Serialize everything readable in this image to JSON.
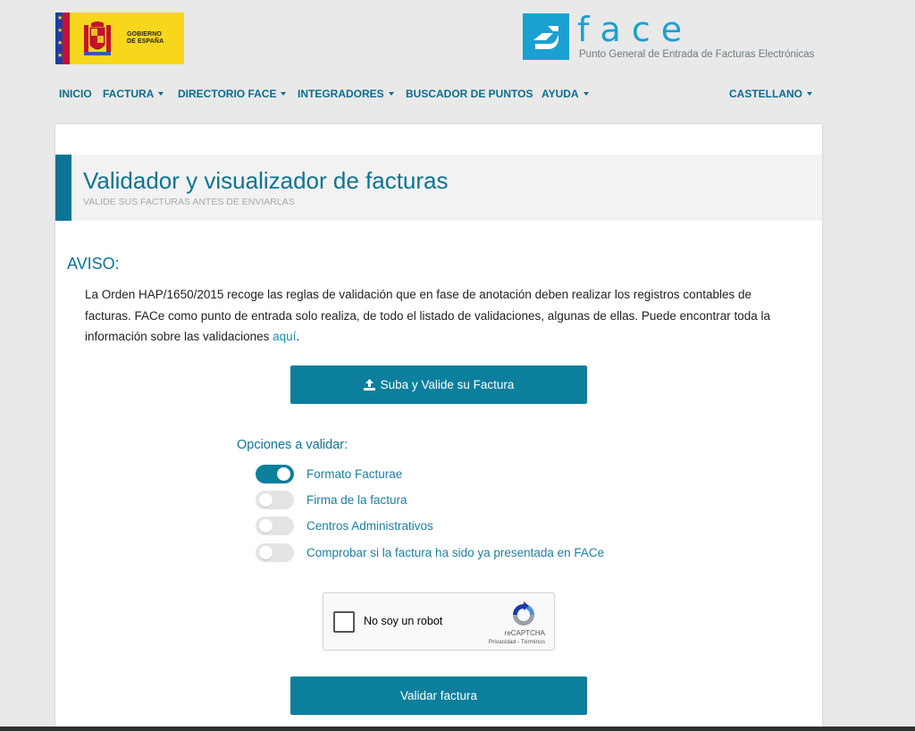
{
  "header": {
    "gov_logo_text": "GOBIERNO\nDE ESPAÑA",
    "face_logo_text": "f a c e",
    "face_subtitle": "Punto General de Entrada de Facturas Electrónicas"
  },
  "nav": {
    "items": [
      {
        "label": "INICIO",
        "dropdown": false
      },
      {
        "label": "FACTURA",
        "dropdown": true
      },
      {
        "label": "DIRECTORIO FACE",
        "dropdown": true
      },
      {
        "label": "INTEGRADORES",
        "dropdown": true
      },
      {
        "label": "BUSCADOR DE PUNTOS",
        "dropdown": false
      },
      {
        "label": "AYUDA",
        "dropdown": true
      }
    ],
    "language": "CASTELLANO"
  },
  "page": {
    "title": "Validador y visualizador de facturas",
    "subtitle": "VALIDE SUS FACTURAS ANTES DE ENVIARLAS"
  },
  "aviso": {
    "title": "AVISO:",
    "text": "La Orden HAP/1650/2015 recoge las reglas de validación que en fase de anotación deben realizar los registros contables de facturas. FACe como punto de entrada solo realiza, de todo el listado de validaciones, algunas de ellas. Puede encontrar toda la información sobre las validaciones ",
    "link_text": "aquí",
    "text_end": "."
  },
  "upload_button": {
    "label": "Suba y Valide su Factura",
    "icon": "upload-icon"
  },
  "options": {
    "title": "Opciones a validar:",
    "items": [
      {
        "label": "Formato Facturae",
        "enabled": true
      },
      {
        "label": "Firma de la factura",
        "enabled": false
      },
      {
        "label": "Centros Administrativos",
        "enabled": false
      },
      {
        "label": "Comprobar si la factura ha sido ya presentada en FACe",
        "enabled": false
      }
    ]
  },
  "captcha": {
    "label": "No soy un robot",
    "brand": "reCAPTCHA",
    "terms": "Privacidad - Términos",
    "checked": false
  },
  "validate_button": {
    "label": "Validar factura"
  },
  "colors": {
    "primary": "#0b7f9c",
    "title": "#0b7494",
    "link": "#1a8fb3",
    "gov_yellow": "#f8d61c",
    "face_blue": "#1aa0d3"
  }
}
